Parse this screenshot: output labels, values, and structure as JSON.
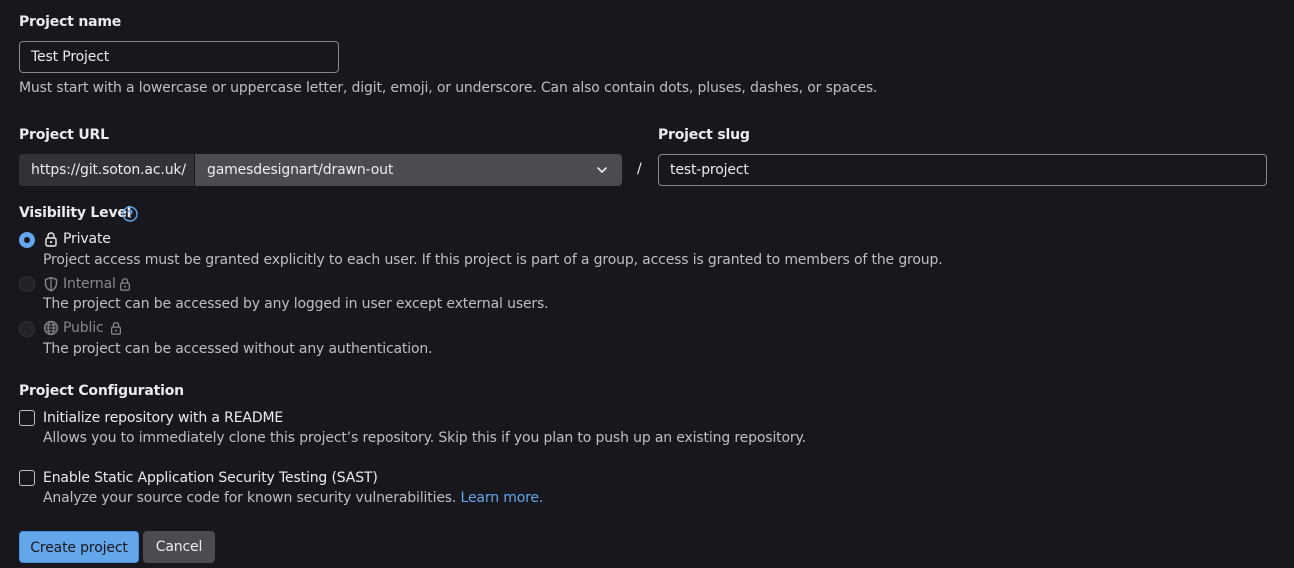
{
  "project_name": {
    "label": "Project name",
    "value": "Test Project",
    "help": "Must start with a lowercase or uppercase letter, digit, emoji, or underscore. Can also contain dots, pluses, dashes, or spaces."
  },
  "project_url": {
    "label": "Project URL",
    "prefix": "https://git.soton.ac.uk/",
    "namespace": "gamesdesignart/drawn-out",
    "separator": "/"
  },
  "project_slug": {
    "label": "Project slug",
    "value": "test-project"
  },
  "visibility": {
    "label": "Visibility Level",
    "options": [
      {
        "label": "Private",
        "description": "Project access must be granted explicitly to each user. If this project is part of a group, access is granted to members of the group.",
        "selected": true,
        "disabled": false,
        "icon": "lock-icon"
      },
      {
        "label": "Internal",
        "description": "The project can be accessed by any logged in user except external users.",
        "selected": false,
        "disabled": true,
        "icon": "shield-icon"
      },
      {
        "label": "Public",
        "description": "The project can be accessed without any authentication.",
        "selected": false,
        "disabled": true,
        "icon": "globe-icon"
      }
    ]
  },
  "configuration": {
    "label": "Project Configuration",
    "options": [
      {
        "label": "Initialize repository with a README",
        "description": "Allows you to immediately clone this project’s repository. Skip this if you plan to push up an existing repository.",
        "checked": false
      },
      {
        "label": "Enable Static Application Security Testing (SAST)",
        "description": "Analyze your source code for known security vulnerabilities.",
        "link": "Learn more.",
        "checked": false
      }
    ]
  },
  "actions": {
    "create": "Create project",
    "cancel": "Cancel"
  },
  "colors": {
    "background": "#18171d",
    "primary": "#63a6e9",
    "text": "#ececef",
    "muted": "#bfbfc3"
  }
}
